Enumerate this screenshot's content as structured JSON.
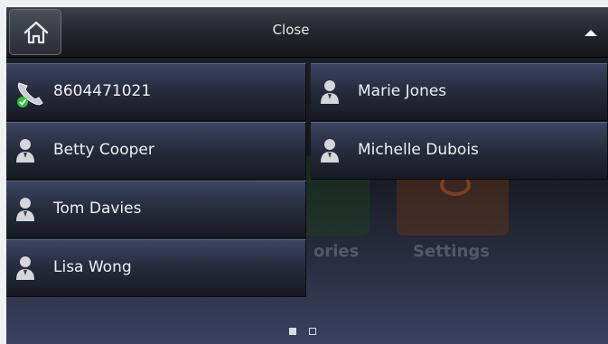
{
  "header": {
    "close_label": "Close"
  },
  "background_apps": {
    "accessories_label": "ories",
    "settings_label": "Settings"
  },
  "contacts": [
    {
      "label": "8604471021",
      "icon": "phone-handset-check-icon"
    },
    {
      "label": "Marie Jones",
      "icon": "person-icon"
    },
    {
      "label": "Betty Cooper",
      "icon": "person-icon"
    },
    {
      "label": "Michelle Dubois",
      "icon": "person-icon"
    },
    {
      "label": "Tom Davies",
      "icon": "person-icon"
    },
    {
      "label": "Lisa Wong",
      "icon": "person-icon"
    }
  ],
  "pager": {
    "current_page": 1,
    "total_pages": 2
  },
  "colors": {
    "tile_top": "#3b4461",
    "tile_bottom": "#171a22",
    "text": "#eef0f4",
    "check_green": "#2fbf3a"
  }
}
